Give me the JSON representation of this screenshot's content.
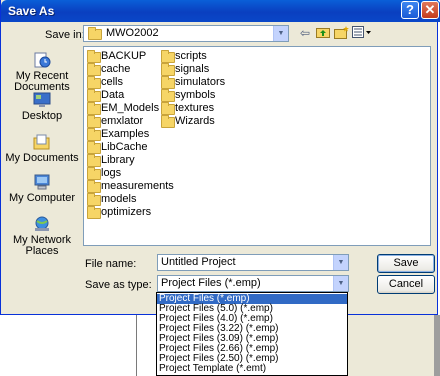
{
  "window": {
    "title": "Save As",
    "help": "?",
    "close": "✕"
  },
  "save_in": {
    "label": "Save in:",
    "value": "MWO2002"
  },
  "toolbar": {
    "back_icon": "back-arrow-icon",
    "up_icon": "up-folder-icon",
    "new_folder_icon": "new-folder-icon",
    "views_icon": "views-menu-icon"
  },
  "places": [
    {
      "label": "My Recent Documents",
      "icon": "recent-documents-icon"
    },
    {
      "label": "Desktop",
      "icon": "desktop-icon"
    },
    {
      "label": "My Documents",
      "icon": "my-documents-icon"
    },
    {
      "label": "My Computer",
      "icon": "my-computer-icon"
    },
    {
      "label": "My Network Places",
      "icon": "network-places-icon"
    }
  ],
  "folders_col1": [
    "BACKUP",
    "cache",
    "cells",
    "Data",
    "EM_Models",
    "emxlator",
    "Examples",
    "LibCache",
    "Library",
    "logs",
    "measurements",
    "models",
    "optimizers"
  ],
  "folders_col2": [
    "scripts",
    "signals",
    "simulators",
    "symbols",
    "textures",
    "Wizards"
  ],
  "file_name": {
    "label": "File name:",
    "value": "Untitled Project"
  },
  "save_as_type": {
    "label": "Save as type:",
    "value": "Project Files (*.emp)"
  },
  "type_options": [
    "Project Files (*.emp)",
    "Project Files (5.0) (*.emp)",
    "Project Files (4.0) (*.emp)",
    "Project Files (3.22) (*.emp)",
    "Project Files (3.09) (*.emp)",
    "Project Files (2.66) (*.emp)",
    "Project Files (2.50) (*.emp)",
    "Project Template (*.emt)"
  ],
  "buttons": {
    "save": "Save",
    "cancel": "Cancel"
  },
  "colors": {
    "title_bar": "#0a47c8",
    "selection": "#316ac5",
    "dialog_bg": "#ece9d8"
  }
}
